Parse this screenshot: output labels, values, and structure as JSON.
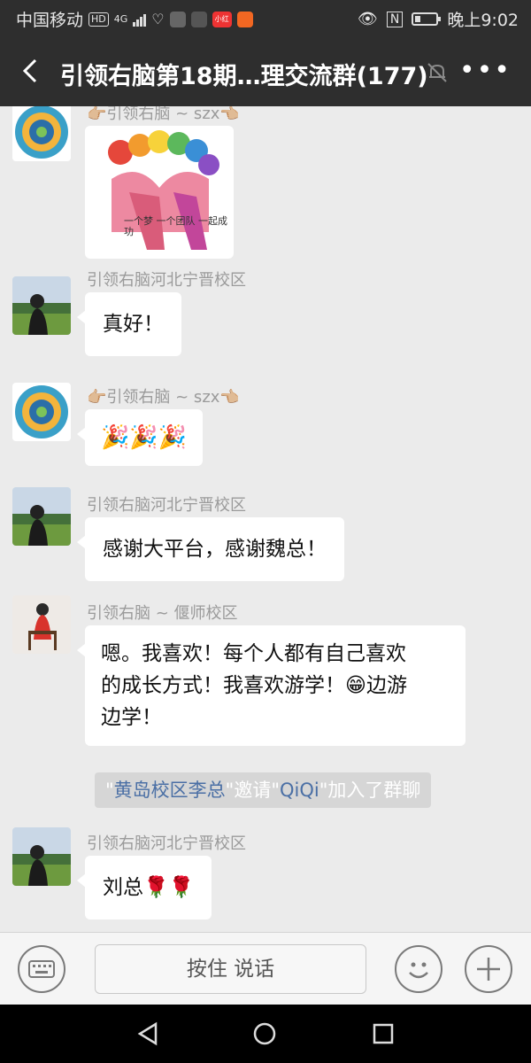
{
  "status_bar": {
    "carrier": "中国移动",
    "hd": "HD",
    "network": "4G",
    "app_badge": "小红书",
    "time": "晚上9:02"
  },
  "header": {
    "title": "引领右脑第18期…理交流群(177)"
  },
  "messages": [
    {
      "sender": "👉🏼引领右脑 ~ szx👈🏼",
      "type": "image",
      "image_caption": "一个梦 一个团队 一起成功"
    },
    {
      "sender": "引领右脑河北宁晋校区",
      "text": "真好！"
    },
    {
      "sender": "👉🏼引领右脑 ~ szx👈🏼",
      "text": "🎉🎉🎉"
    },
    {
      "sender": "引领右脑河北宁晋校区",
      "text": "感谢大平台，感谢魏总！"
    },
    {
      "sender": "引领右脑 ~ 偃师校区",
      "lines": [
        "嗯。我喜欢！每个人都有自己喜欢",
        "的成长方式！我喜欢游学！😁边游",
        "边学！"
      ]
    },
    {
      "sender": "引领右脑河北宁晋校区",
      "text": "刘总🌹🌹"
    }
  ],
  "system_notice": {
    "q1": "\"",
    "inviter": "黄岛校区李总",
    "mid": "\"邀请\"",
    "invitee": "QiQi",
    "tail": "\"加入了群聊"
  },
  "input_bar": {
    "hold_to_talk": "按住 说话"
  },
  "colors": {
    "header_bg": "#2e2e2e",
    "chat_bg": "#ebebeb",
    "bubble_bg": "#ffffff",
    "link": "#4a6fa5"
  }
}
